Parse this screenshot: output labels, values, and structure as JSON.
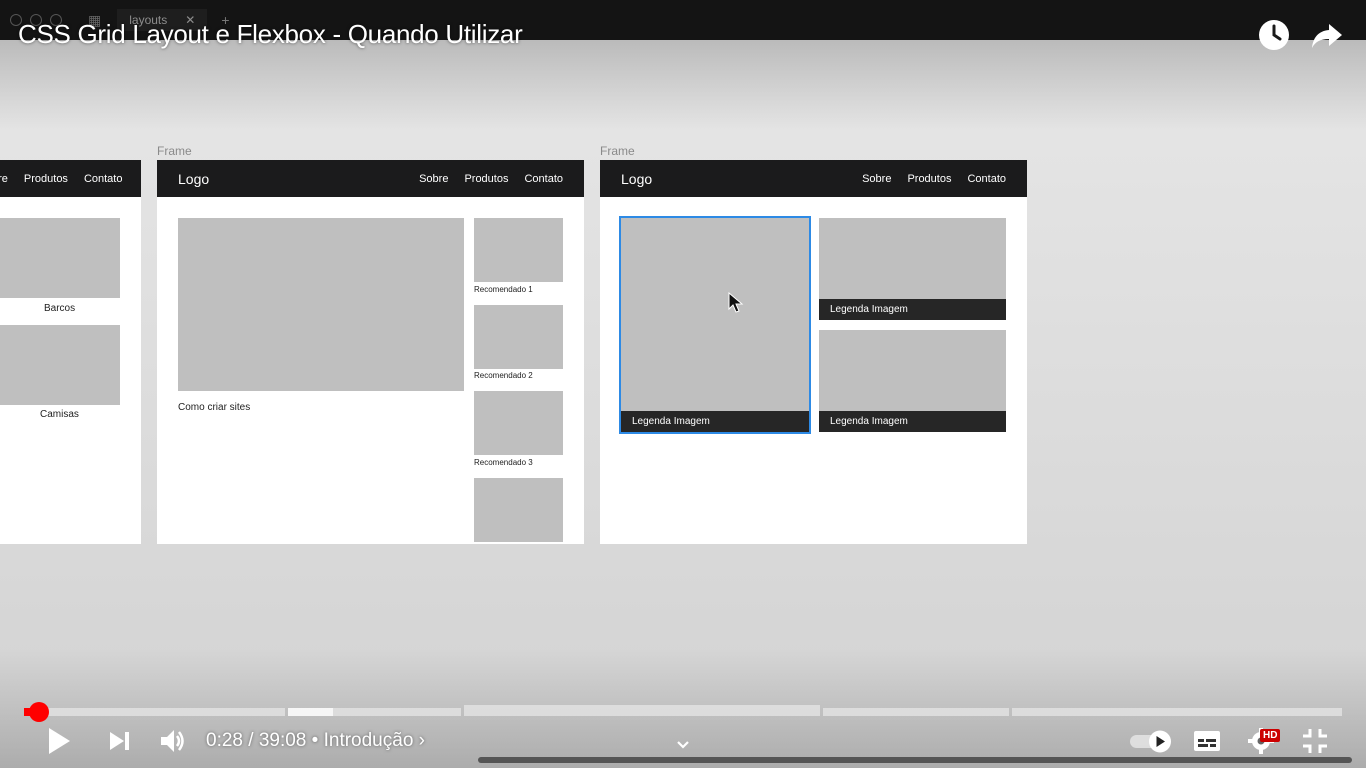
{
  "app": {
    "tab_label": "layouts",
    "tab_close": "✕",
    "new_tab": "+"
  },
  "video": {
    "title": "CSS Grid Layout e Flexbox - Quando Utilizar",
    "watch_later_icon": "clock-icon",
    "share_icon": "share-arrow-icon"
  },
  "frames": {
    "label": "Frame",
    "left": {
      "nav_links": [
        "bre",
        "Produtos",
        "Contato"
      ],
      "captions": [
        "Barcos",
        "Camisas"
      ]
    },
    "middle": {
      "logo": "Logo",
      "nav_links": [
        "Sobre",
        "Produtos",
        "Contato"
      ],
      "main_caption": "Como criar sites",
      "recommended": [
        "Recomendado 1",
        "Recomendado 2",
        "Recomendado 3"
      ]
    },
    "right": {
      "logo": "Logo",
      "nav_links": [
        "Sobre",
        "Produtos",
        "Contato"
      ],
      "image_legends": [
        "Legenda Imagem",
        "Legenda Imagem",
        "Legenda Imagem"
      ],
      "selection_color": "#2d8ae5"
    }
  },
  "player": {
    "played_fraction": 0.0114,
    "current_time": "0:28",
    "separator": " / ",
    "duration": "39:08",
    "chapter_bullet": " • ",
    "chapter": "Introdução",
    "chapter_arrow": "›",
    "hd_badge": "HD",
    "accent_color": "#ff0000",
    "icons": [
      "play-icon",
      "next-icon",
      "volume-icon",
      "chevron-down-icon",
      "autoplay-toggle-icon",
      "subtitles-icon",
      "settings-icon",
      "exit-fullscreen-icon"
    ]
  }
}
